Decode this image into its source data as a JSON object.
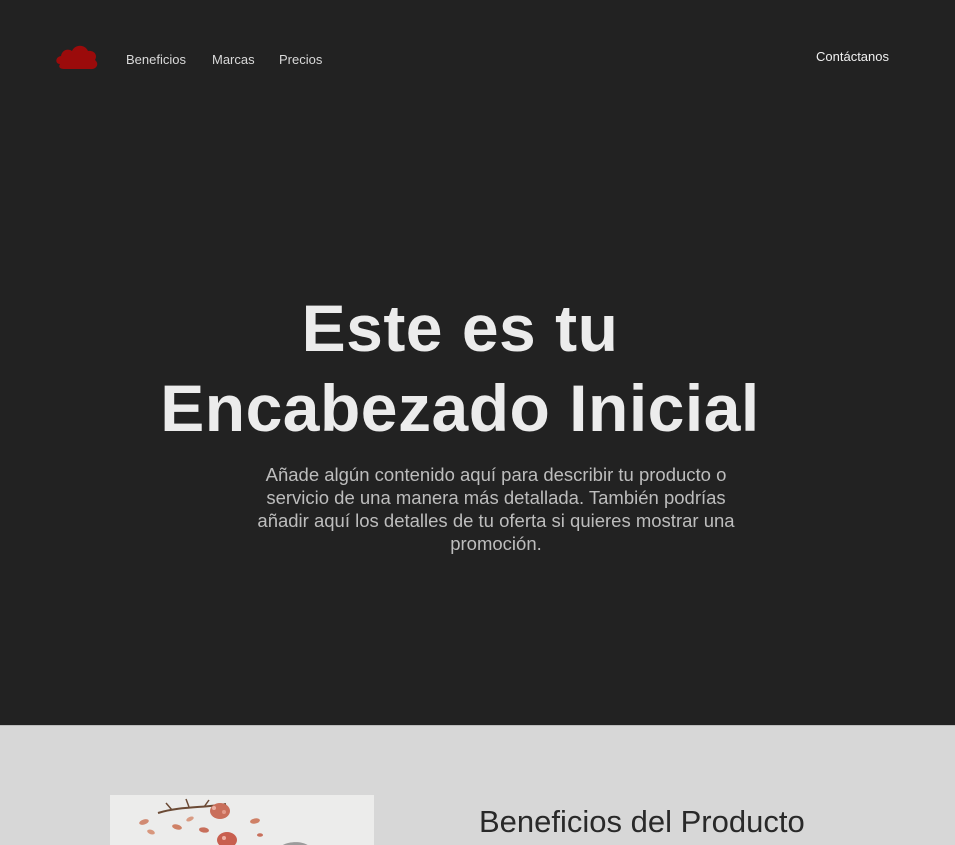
{
  "header": {
    "logo": "red-cloud-logo",
    "nav_links": [
      "Beneficios",
      "Marcas",
      "Precios"
    ],
    "contact_label": "Contáctanos"
  },
  "hero": {
    "title_line_1": "Este es tu",
    "title_line_2": "Encabezado Inicial",
    "description": "Añade algún contenido aquí para describir tu producto o servicio de una manera más detallada. También podrías añadir aquí los detalles de tu oferta si quieres mostrar una promoción."
  },
  "benefits": {
    "title": "Beneficios del Producto"
  },
  "colors": {
    "hero_background": "#222222",
    "section_background": "#d7d7d7",
    "logo": "#9b0b0b",
    "heading": "#ececec",
    "text": "#bdbdbd",
    "section_heading": "#292929"
  }
}
